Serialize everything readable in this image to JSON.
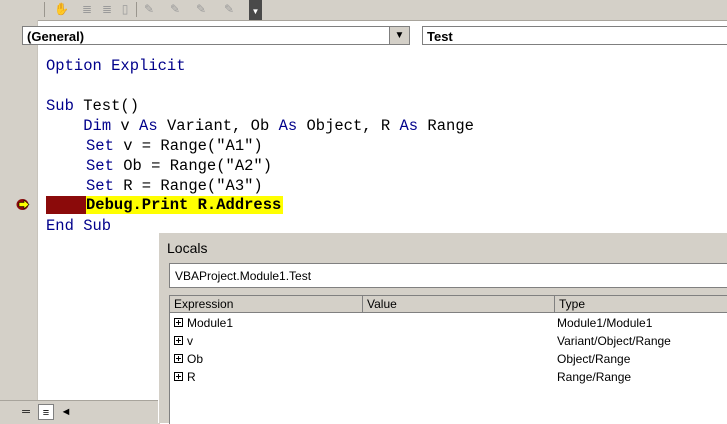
{
  "toolbar": {
    "icons": [
      "hand-icon",
      "indent-icon",
      "outdent-icon",
      "toggle-breakpoint-icon",
      "bookmark-icon",
      "next-bookmark-icon",
      "previous-bookmark-icon",
      "clear-bookmarks-icon"
    ],
    "overflow_glyph": "▼"
  },
  "editor": {
    "object_selector": "(General)",
    "procedure_selector": "Test",
    "dropdown_glyph": "▼",
    "lines": [
      {
        "keyword": "Option Explicit",
        "rest": ""
      },
      {
        "keyword": "",
        "rest": ""
      },
      {
        "keyword": "Sub",
        "rest": " Test()"
      },
      {
        "indent": "    ",
        "dim_kw": "Dim",
        "dim_rest_1": " v ",
        "as1": "As",
        "dim_rest_2": " Variant, Ob ",
        "as2": "As",
        "dim_rest_3": " Object, R ",
        "as3": "As",
        "dim_rest_4": " Range"
      },
      {
        "keyword": "Set",
        "rest": " v = Range(\"A1\")"
      },
      {
        "keyword": "Set",
        "rest": " Ob = Range(\"A2\")"
      },
      {
        "keyword": "Set",
        "rest": " R = Range(\"A3\")"
      },
      {
        "text": "Debug.Print R.Address"
      },
      {
        "keyword": "End Sub",
        "rest": ""
      }
    ],
    "highlight_color": "#ffff00",
    "breakpoint_color": "#8b0a0a",
    "keyword_color": "#00008b"
  },
  "locals": {
    "title": "Locals",
    "context": "VBAProject.Module1.Test",
    "columns": [
      "Expression",
      "Value",
      "Type"
    ],
    "rows": [
      {
        "expression": "Module1",
        "value": "",
        "type": "Module1/Module1"
      },
      {
        "expression": "v",
        "value": "",
        "type": "Variant/Object/Range"
      },
      {
        "expression": "Ob",
        "value": "",
        "type": "Object/Range"
      },
      {
        "expression": "R",
        "value": "",
        "type": "Range/Range"
      }
    ]
  },
  "bottom_bar": {
    "procedure_view_glyph": "═",
    "full_module_view_glyph": "≡",
    "scroll_left_glyph": "◄"
  }
}
